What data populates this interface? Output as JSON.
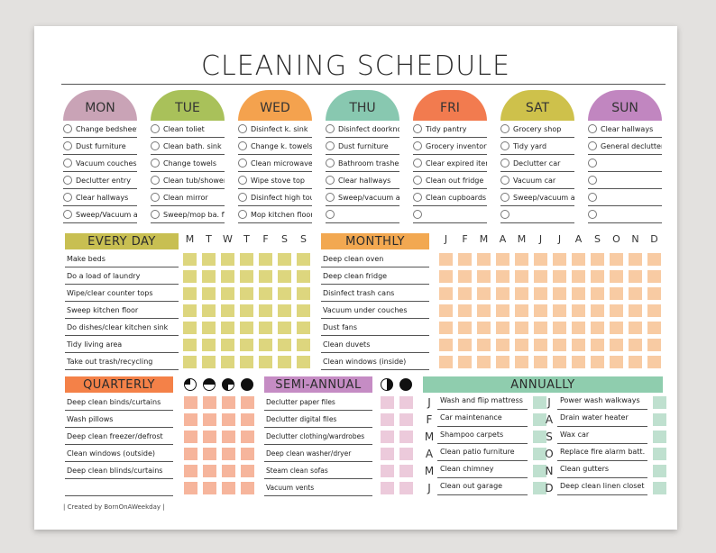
{
  "title": "CLEANING SCHEDULE",
  "colors": {
    "mon": "#c9a3b6",
    "tue": "#a9c15a",
    "wed": "#f4a24e",
    "thu": "#88c8b0",
    "fri": "#f27b4f",
    "sat": "#cec14b",
    "sun": "#c186c0",
    "everyday_header": "#c8bf52",
    "everyday_box": "#ddd67e",
    "monthly_header": "#f2a851",
    "monthly_box": "#f8cba3",
    "quarterly_header": "#f48148",
    "quarterly_box": "#f6b59c",
    "semiannual_header": "#c58cc4",
    "semiannual_box": "#eccadb",
    "annually_header": "#8fcdae",
    "annually_box": "#bfe0cf"
  },
  "days": [
    {
      "name": "MON",
      "tasks": [
        "Change bedsheets",
        "Dust furniture",
        "Vacuum couches",
        "Declutter entry",
        "Clear hallways",
        "Sweep/Vacuum all"
      ]
    },
    {
      "name": "TUE",
      "tasks": [
        "Clean toliet",
        "Clean bath. sink",
        "Change towels",
        "Clean tub/shower",
        "Clean mirror",
        "Sweep/mop ba. floor"
      ]
    },
    {
      "name": "WED",
      "tasks": [
        "Disinfect k. sink",
        "Change k. towels",
        "Clean microwave",
        "Wipe stove top",
        "Disinfect high touch",
        "Mop kitchen floor"
      ]
    },
    {
      "name": "THU",
      "tasks": [
        "Disinfect doorknobs",
        "Dust furniture",
        "Bathroom trashes",
        "Clear hallways",
        "Sweep/vacuum all",
        ""
      ]
    },
    {
      "name": "FRI",
      "tasks": [
        "Tidy pantry",
        "Grocery inventory",
        "Clear expired items",
        "Clean out fridge",
        "Clean cupboards",
        ""
      ]
    },
    {
      "name": "SAT",
      "tasks": [
        "Grocery shop",
        "Tidy yard",
        "Declutter car",
        "Vacuum car",
        "Sweep/vacuum all",
        ""
      ]
    },
    {
      "name": "SUN",
      "tasks": [
        "Clear hallways",
        "General declutter",
        "",
        "",
        "",
        ""
      ]
    }
  ],
  "everyday": {
    "title": "EVERY DAY",
    "columns": [
      "M",
      "T",
      "W",
      "T",
      "F",
      "S",
      "S"
    ],
    "tasks": [
      "Make beds",
      "Do a load of laundry",
      "Wipe/clear counter tops",
      "Sweep kitchen floor",
      "Do dishes/clear kitchen sink",
      "Tidy living area",
      "Take out trash/recycling"
    ]
  },
  "monthly": {
    "title": "MONTHLY",
    "columns": [
      "J",
      "F",
      "M",
      "A",
      "M",
      "J",
      "J",
      "A",
      "S",
      "O",
      "N",
      "D"
    ],
    "tasks": [
      "Deep clean oven",
      "Deep clean fridge",
      "Disinfect trash cans",
      "Vacuum under couches",
      "Dust fans",
      "Clean duvets",
      "Clean windows (inside)"
    ]
  },
  "quarterly": {
    "title": "QUARTERLY",
    "column_icons": [
      "quarter-moon-icon",
      "half-moon-icon",
      "three-quarter-moon-icon",
      "full-moon-icon"
    ],
    "tasks": [
      "Deep clean binds/curtains",
      "Wash pillows",
      "Deep clean freezer/defrost",
      "Clean windows (outside)",
      "Deep clean blinds/curtains",
      ""
    ]
  },
  "semiannual": {
    "title": "SEMI-ANNUAL",
    "column_icons": [
      "half-moon-icon",
      "full-moon-icon"
    ],
    "tasks": [
      "Declutter paper files",
      "Declutter digital files",
      "Declutter clothing/wardrobes",
      "Deep clean washer/dryer",
      "Steam clean sofas",
      "Vacuum vents"
    ]
  },
  "annually": {
    "title": "ANNUALLY",
    "left": [
      {
        "month": "J",
        "task": "Wash and flip mattress"
      },
      {
        "month": "F",
        "task": "Car maintenance"
      },
      {
        "month": "M",
        "task": "Shampoo carpets"
      },
      {
        "month": "A",
        "task": "Clean patio furniture"
      },
      {
        "month": "M",
        "task": "Clean chimney"
      },
      {
        "month": "J",
        "task": "Clean out garage"
      }
    ],
    "right": [
      {
        "month": "J",
        "task": "Power wash walkways"
      },
      {
        "month": "A",
        "task": "Drain water heater"
      },
      {
        "month": "S",
        "task": "Wax car"
      },
      {
        "month": "O",
        "task": "Replace fire alarm batt."
      },
      {
        "month": "N",
        "task": "Clean gutters"
      },
      {
        "month": "D",
        "task": "Deep clean linen closet"
      }
    ]
  },
  "footer": "| Created by BornOnAWeekday |"
}
